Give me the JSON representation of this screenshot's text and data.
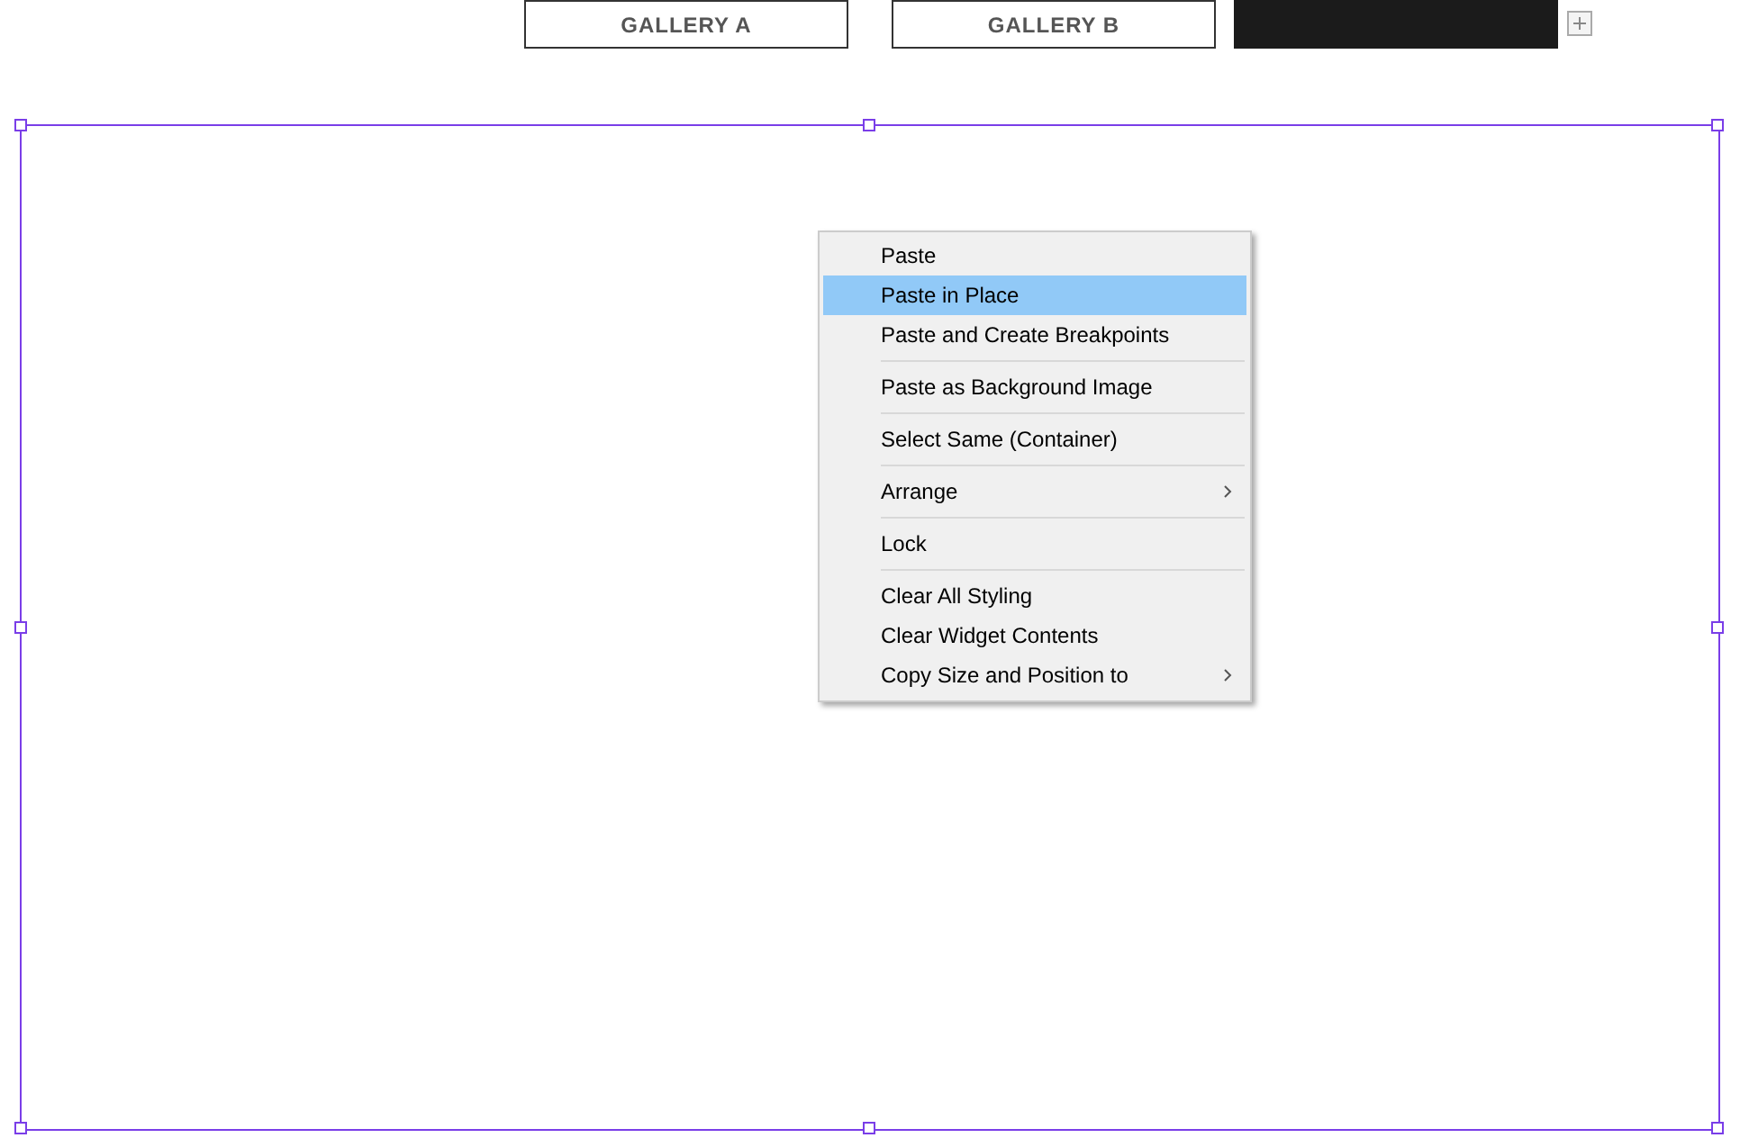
{
  "tabs": [
    {
      "label": "GALLERY A",
      "selected": false
    },
    {
      "label": "GALLERY B",
      "selected": false
    },
    {
      "selected": true
    }
  ],
  "add_button": {
    "kind": "plus"
  },
  "selection": {
    "handles": true
  },
  "context_menu": {
    "items": [
      {
        "kind": "item",
        "label": "Paste",
        "selected": false,
        "has_submenu": false
      },
      {
        "kind": "item",
        "label": "Paste in Place",
        "selected": true,
        "has_submenu": false
      },
      {
        "kind": "item",
        "label": "Paste and Create Breakpoints",
        "selected": false,
        "has_submenu": false
      },
      {
        "kind": "separator"
      },
      {
        "kind": "item",
        "label": "Paste as Background Image",
        "selected": false,
        "has_submenu": false
      },
      {
        "kind": "separator"
      },
      {
        "kind": "item",
        "label": "Select Same (Container)",
        "selected": false,
        "has_submenu": false
      },
      {
        "kind": "separator"
      },
      {
        "kind": "item",
        "label": "Arrange",
        "selected": false,
        "has_submenu": true
      },
      {
        "kind": "separator"
      },
      {
        "kind": "item",
        "label": "Lock",
        "selected": false,
        "has_submenu": false
      },
      {
        "kind": "separator"
      },
      {
        "kind": "item",
        "label": "Clear All Styling",
        "selected": false,
        "has_submenu": false
      },
      {
        "kind": "item",
        "label": "Clear Widget Contents",
        "selected": false,
        "has_submenu": false
      },
      {
        "kind": "item",
        "label": "Copy Size and Position to",
        "selected": false,
        "has_submenu": true
      }
    ]
  }
}
